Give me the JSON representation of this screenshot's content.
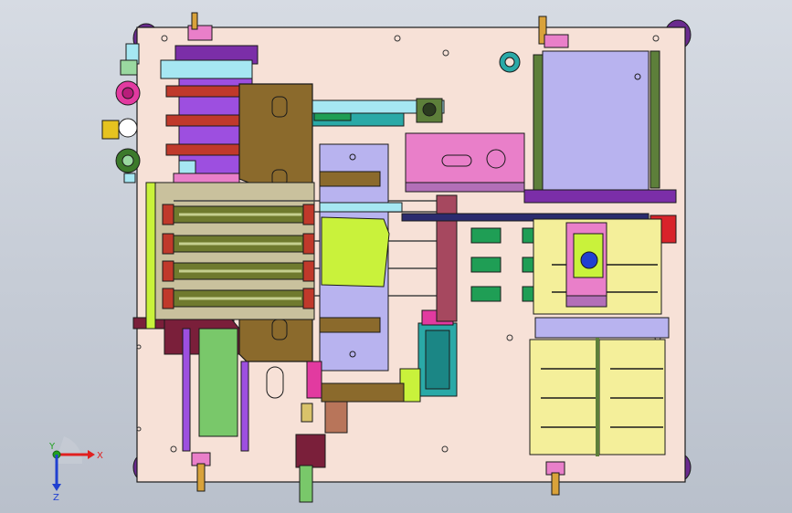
{
  "viewport": {
    "background_top": "#d6dbe3",
    "background_bottom": "#b9c0cb"
  },
  "colors": {
    "base_plate": "#f7e1d7",
    "outline": "#1a1a1a",
    "brown_plate": "#8b6a2c",
    "olive_cylinder": "#6f7a2e",
    "purple": "#7b2ea8",
    "magenta": "#e23aa0",
    "pink": "#e97fc9",
    "yellow": "#f4ef9a",
    "green": "#1f9e55",
    "lime": "#c9f23b",
    "light_blue": "#a6e7f2",
    "teal": "#2aa9a7",
    "lavender": "#b8b3ef",
    "red": "#d8232a",
    "light_green": "#79c86a"
  },
  "triad": {
    "x_label": "X",
    "y_label": "Y",
    "z_label": "Z",
    "x_color": "#e02020",
    "y_color": "#20a020",
    "z_color": "#2040d0"
  }
}
